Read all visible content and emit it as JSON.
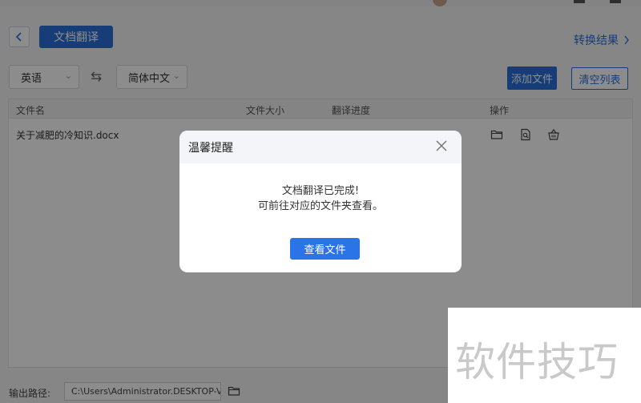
{
  "header": {
    "back_icon": "chevron-left-icon",
    "title": "文档翻译",
    "result_link": "转换结果",
    "result_icon": "chevron-right-icon"
  },
  "toolbar": {
    "source_lang": "英语",
    "swap_icon": "swap-arrows-icon",
    "target_lang": "简体中文",
    "add_file_label": "添加文件",
    "clear_list_label": "清空列表"
  },
  "table": {
    "columns": [
      "文件名",
      "文件大小",
      "翻译进度",
      "操作"
    ],
    "rows": [
      {
        "file_name": "关于减肥的冷知识.docx",
        "actions": [
          "folder-icon",
          "preview-icon",
          "delete-basket-icon"
        ]
      }
    ]
  },
  "footer": {
    "output_label": "输出路径:",
    "output_path": "C:\\Users\\Administrator.DESKTOP-V...",
    "folder_icon": "folder-icon"
  },
  "modal": {
    "title": "温馨提醒",
    "close_icon": "close-icon",
    "message_line1": "文档翻译已完成!",
    "message_line2": "可前往对应的文件夹查看。",
    "view_button": "查看文件"
  },
  "watermark": {
    "text": "软件技巧"
  },
  "colors": {
    "accent": "#2a6fdb",
    "overlay": "rgba(0,0,0,0.45)"
  }
}
